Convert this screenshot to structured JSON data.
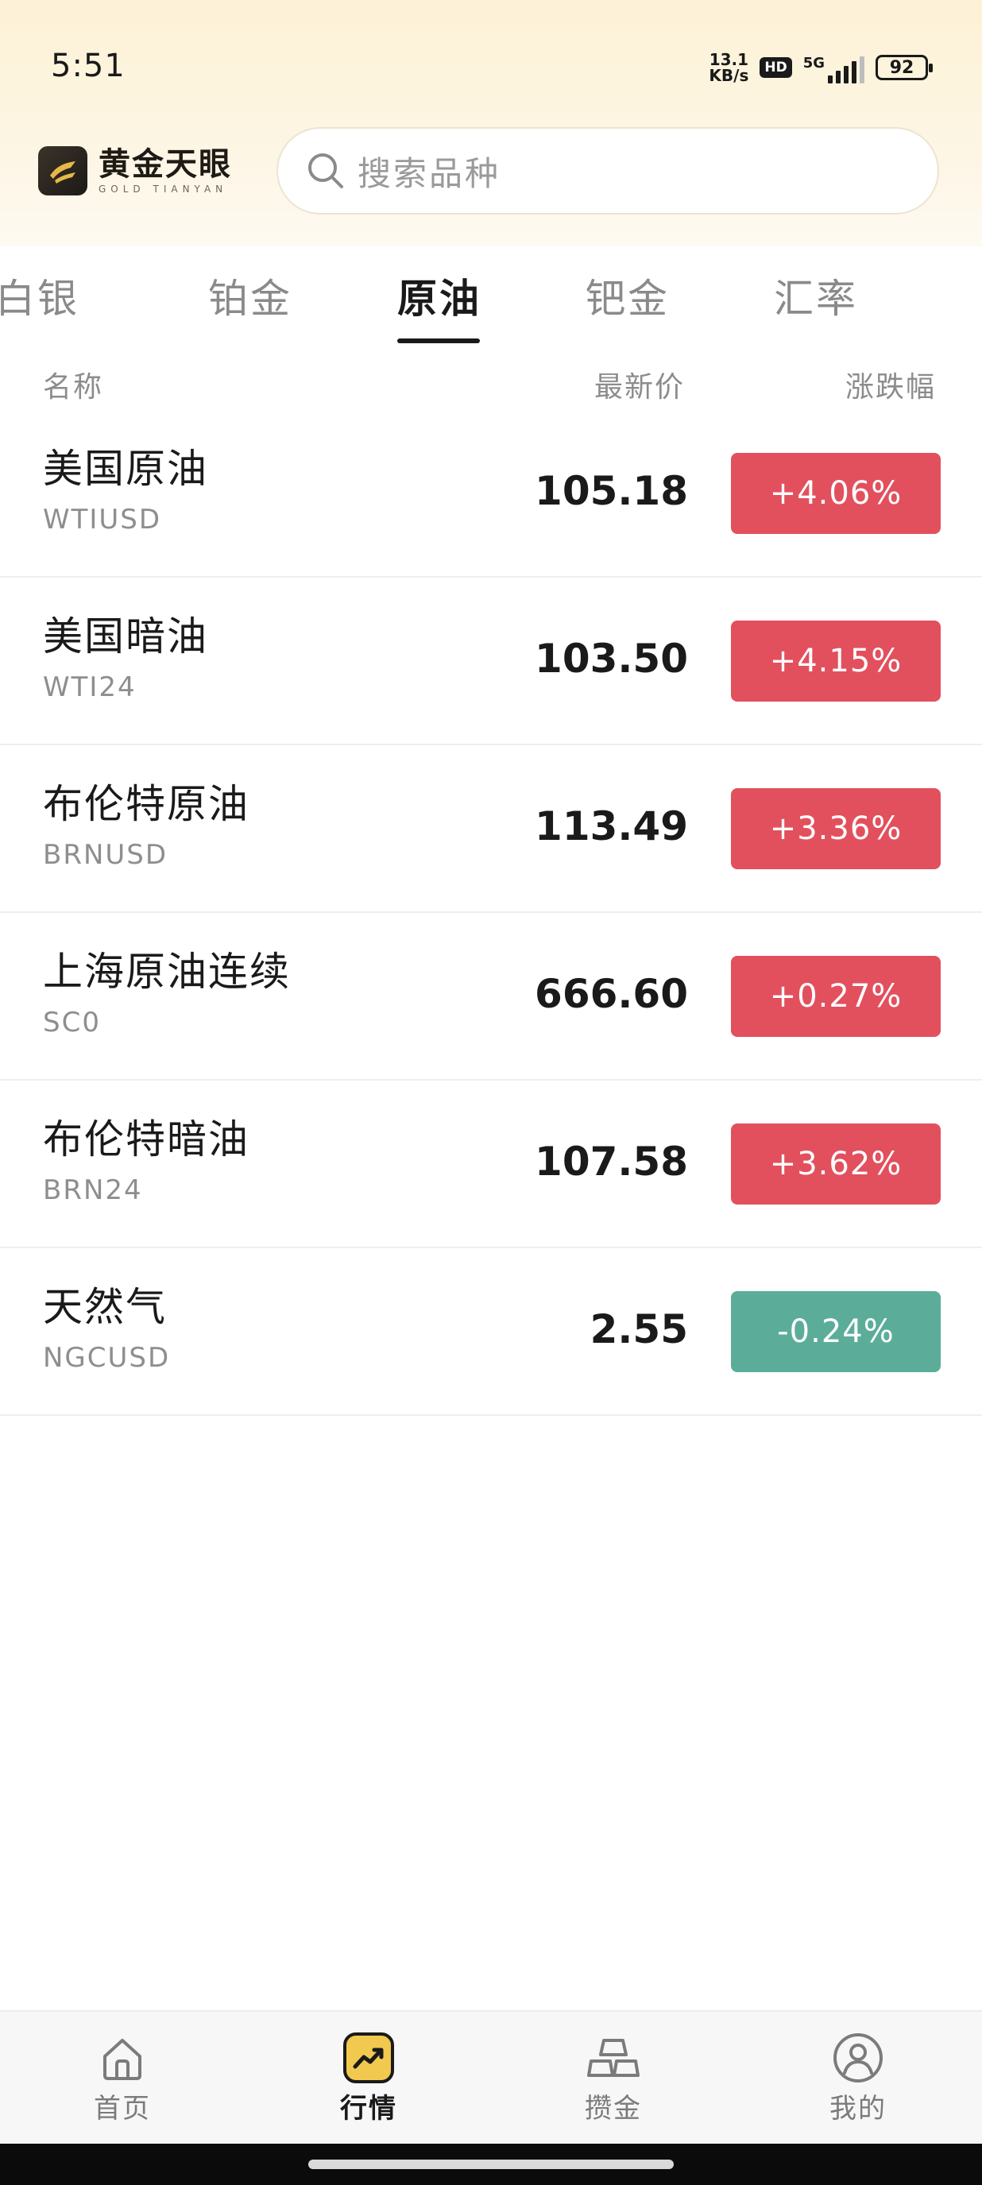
{
  "status_bar": {
    "time": "5:51",
    "net_speed_value": "13.1",
    "net_speed_unit": "KB/s",
    "hd_badge": "HD",
    "signal_label": "5G",
    "battery": "92"
  },
  "header": {
    "logo_cn": "黄金天眼",
    "logo_en": "GOLD TIANYAN",
    "search_placeholder": "搜索品种"
  },
  "tabs": [
    {
      "label": "白银",
      "active": false
    },
    {
      "label": "铂金",
      "active": false
    },
    {
      "label": "原油",
      "active": true
    },
    {
      "label": "钯金",
      "active": false
    },
    {
      "label": "汇率",
      "active": false
    }
  ],
  "columns": {
    "name": "名称",
    "price": "最新价",
    "change": "涨跌幅"
  },
  "rows": [
    {
      "name": "美国原油",
      "code": "WTIUSD",
      "price": "105.18",
      "change": "+4.06%",
      "direction": "up"
    },
    {
      "name": "美国暗油",
      "code": "WTI24",
      "price": "103.50",
      "change": "+4.15%",
      "direction": "up"
    },
    {
      "name": "布伦特原油",
      "code": "BRNUSD",
      "price": "113.49",
      "change": "+3.36%",
      "direction": "up"
    },
    {
      "name": "上海原油连续",
      "code": "SC0",
      "price": "666.60",
      "change": "+0.27%",
      "direction": "up"
    },
    {
      "name": "布伦特暗油",
      "code": "BRN24",
      "price": "107.58",
      "change": "+3.62%",
      "direction": "up"
    },
    {
      "name": "天然气",
      "code": "NGCUSD",
      "price": "2.55",
      "change": "-0.24%",
      "direction": "down"
    }
  ],
  "bottom_nav": [
    {
      "label": "首页",
      "icon": "home-icon",
      "active": false
    },
    {
      "label": "行情",
      "icon": "market-chart-icon",
      "active": true
    },
    {
      "label": "攒金",
      "icon": "gold-bars-icon",
      "active": false
    },
    {
      "label": "我的",
      "icon": "profile-icon",
      "active": false
    }
  ],
  "colors": {
    "up": "#e2505e",
    "down": "#5bad9a",
    "header_bg": "#fdf2d6",
    "accent_gold": "#e6b84a"
  }
}
